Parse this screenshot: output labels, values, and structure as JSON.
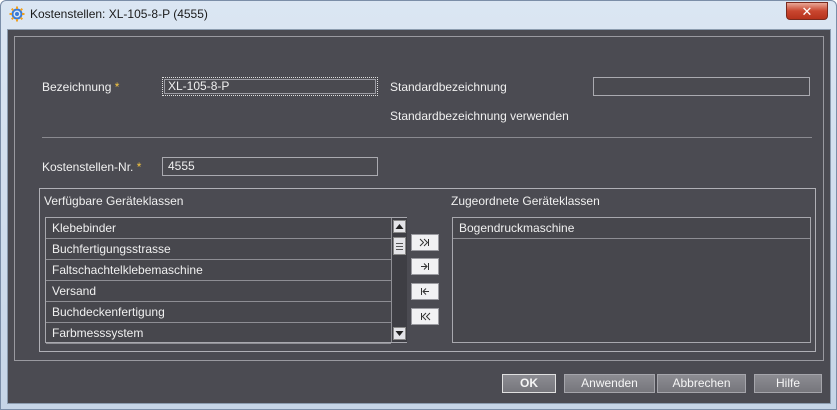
{
  "window": {
    "title": "Kostenstellen: XL-105-8-P (4555)",
    "close_label": "✕"
  },
  "form": {
    "bezeichnung_label": "Bezeichnung",
    "required_marker": "*",
    "bezeichnung_value": "XL-105-8-P",
    "standard_label": "Standardbezeichnung",
    "standard_value": "",
    "standard_use_label": "Standardbezeichnung verwenden",
    "nr_label": "Kostenstellen-Nr.",
    "nr_value": "4555"
  },
  "available": {
    "title": "Verfügbare Geräteklassen",
    "items": [
      "Klebebinder",
      "Buchfertigungsstrasse",
      "Faltschachtelklebemaschine",
      "Versand",
      "Buchdeckenfertigung",
      "Farbmesssystem"
    ]
  },
  "assigned": {
    "title": "Zugeordnete Geräteklassen",
    "items": [
      "Bogendruckmaschine"
    ]
  },
  "buttons": {
    "ok": "OK",
    "apply": "Anwenden",
    "cancel": "Abbrechen",
    "help": "Hilfe"
  },
  "colors": {
    "background": "#4b4b52",
    "required": "#f4c542",
    "close": "#c9462f"
  }
}
